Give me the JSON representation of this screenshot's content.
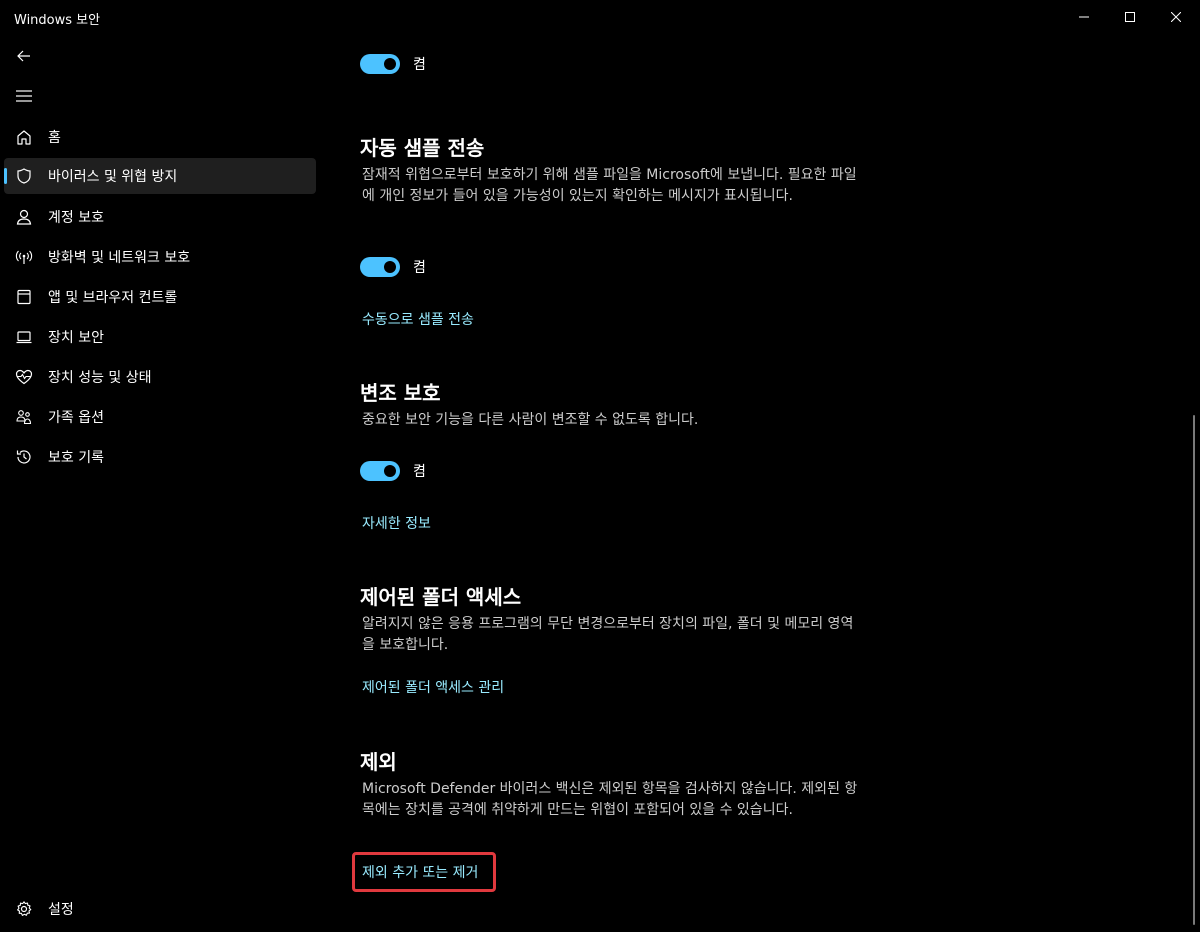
{
  "window": {
    "title": "Windows 보안"
  },
  "sidebar": {
    "items": [
      {
        "label": "홈",
        "icon": "home-icon"
      },
      {
        "label": "바이러스 및 위협 방지",
        "icon": "shield-icon",
        "active": true
      },
      {
        "label": "계정 보호",
        "icon": "person-icon"
      },
      {
        "label": "방화벽 및 네트워크 보호",
        "icon": "antenna-icon"
      },
      {
        "label": "앱 및 브라우저 컨트롤",
        "icon": "app-window-icon"
      },
      {
        "label": "장치 보안",
        "icon": "laptop-icon"
      },
      {
        "label": "장치 성능 및 상태",
        "icon": "heart-pulse-icon"
      },
      {
        "label": "가족 옵션",
        "icon": "family-icon"
      },
      {
        "label": "보호 기록",
        "icon": "history-icon"
      }
    ],
    "settings_label": "설정"
  },
  "main": {
    "top_toggle": {
      "label": "켬",
      "on": true
    },
    "sample_submission": {
      "title": "자동 샘플 전송",
      "description": "잠재적 위협으로부터 보호하기 위해 샘플 파일을 Microsoft에 보냅니다. 필요한 파일에 개인 정보가 들어 있을 가능성이 있는지 확인하는 메시지가 표시됩니다.",
      "toggle_label": "켬",
      "toggle_on": true,
      "link": "수동으로 샘플 전송"
    },
    "tamper_protection": {
      "title": "변조 보호",
      "description": "중요한 보안 기능을 다른 사람이 변조할 수 없도록 합니다.",
      "toggle_label": "켬",
      "toggle_on": true,
      "link": "자세한 정보"
    },
    "controlled_folder": {
      "title": "제어된 폴더 액세스",
      "description": "알려지지 않은 응용 프로그램의 무단 변경으로부터 장치의 파일, 폴더 및 메모리 영역을 보호합니다.",
      "link": "제어된 폴더 액세스 관리"
    },
    "exclusions": {
      "title": "제외",
      "description": "Microsoft Defender 바이러스 백신은 제외된 항목을 검사하지 않습니다. 제외된 항목에는 장치를 공격에 취약하게 만드는 위협이 포함되어 있을 수 있습니다.",
      "link": "제외 추가 또는 제거"
    }
  },
  "colors": {
    "background": "#000000",
    "accent": "#4cc2ff",
    "link": "#99ebff",
    "highlight": "#e0393e"
  }
}
